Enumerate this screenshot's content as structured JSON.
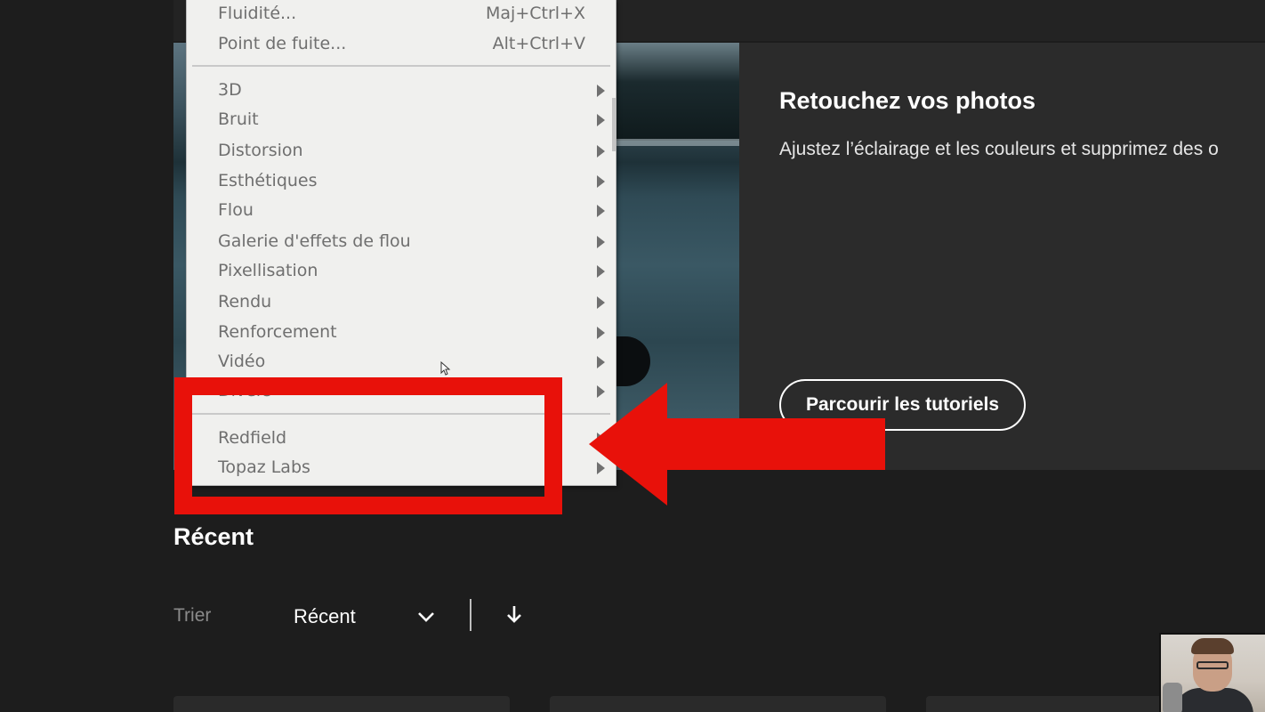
{
  "hero": {
    "title": "Retouchez vos photos",
    "description": "Ajustez l’éclairage et les couleurs et supprimez des o",
    "button_label": "Parcourir les tutoriels"
  },
  "recent": {
    "title": "Récent",
    "sort_label": "Trier",
    "sort_value": "Récent"
  },
  "filter_menu": {
    "top_items": [
      {
        "label": "Fluidité...",
        "shortcut": "Maj+Ctrl+X"
      },
      {
        "label": "Point de fuite...",
        "shortcut": "Alt+Ctrl+V"
      }
    ],
    "submenus": [
      "3D",
      "Bruit",
      "Distorsion",
      "Esthétiques",
      "Flou",
      "Galerie d'effets de flou",
      "Pixellisation",
      "Rendu",
      "Renforcement",
      "Vidéo",
      "Divers"
    ],
    "plugins": [
      "Redfield",
      "Topaz Labs"
    ]
  },
  "annotation": {
    "color": "#e8110a"
  }
}
